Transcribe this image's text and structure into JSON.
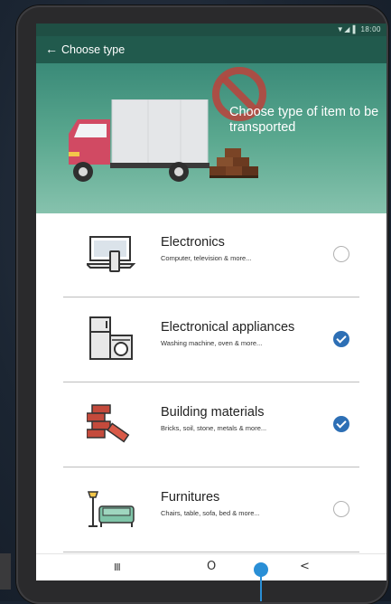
{
  "app": {
    "title": "Choose type",
    "back_icon": "arrow-left-icon"
  },
  "statusbar": {
    "right_text": "▼◢ ▌ 18:00"
  },
  "hero": {
    "text": "Choose type of item to be transported",
    "overlay_icon": "no-entry-icon"
  },
  "items": [
    {
      "title": "Electronics",
      "subtitle": "Computer, television & more...",
      "icon": "laptop-icon",
      "selected": false
    },
    {
      "title": "Electronical appliances",
      "subtitle": "Washing machine, oven & more...",
      "icon": "fridge-washer-icon",
      "selected": true
    },
    {
      "title": "Building materials",
      "subtitle": "Bricks, soil, stone, metals & more...",
      "icon": "bricks-icon",
      "selected": true
    },
    {
      "title": "Furnitures",
      "subtitle": "Chairs, table, sofa, bed & more...",
      "icon": "sofa-lamp-icon",
      "selected": false
    }
  ],
  "navbar": {
    "recents": "III",
    "home": "O",
    "back": "<"
  },
  "colors": {
    "appbar": "#215a4d",
    "hero_top": "#3a8a78",
    "hero_bottom": "#86c2ad",
    "check": "#2d6fb5",
    "touch_indicator": "#2a8fd6"
  }
}
